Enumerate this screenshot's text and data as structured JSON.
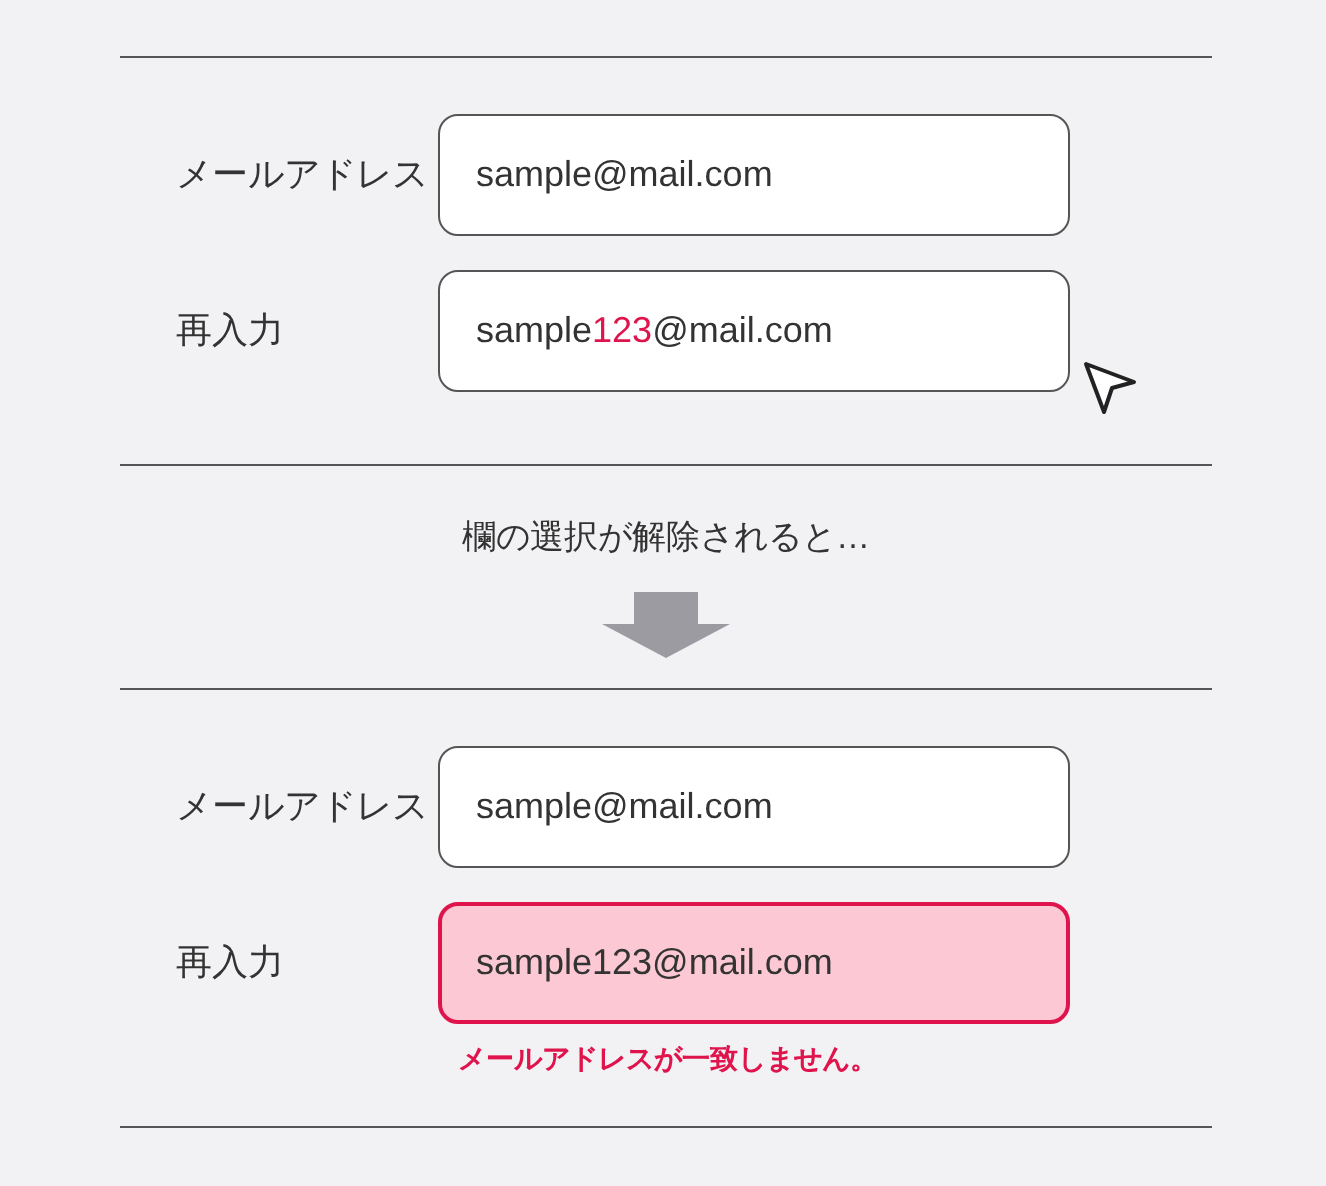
{
  "panels": [
    {
      "cursor": true,
      "rows": [
        {
          "label": "メールアドレス",
          "error": false,
          "value": [
            {
              "text": "sample@mail.com",
              "highlight": false
            }
          ]
        },
        {
          "label": "再入力",
          "error": false,
          "value": [
            {
              "text": "sample",
              "highlight": false
            },
            {
              "text": "123",
              "highlight": true
            },
            {
              "text": "@mail.com",
              "highlight": false
            }
          ]
        }
      ]
    },
    {
      "cursor": false,
      "rows": [
        {
          "label": "メールアドレス",
          "error": false,
          "value": [
            {
              "text": "sample@mail.com",
              "highlight": false
            }
          ]
        },
        {
          "label": "再入力",
          "error": true,
          "error_message": "メールアドレスが一致しません。",
          "value": [
            {
              "text": "sample123@mail.com",
              "highlight": false
            }
          ]
        }
      ]
    }
  ],
  "caption": "欄の選択が解除されると…"
}
